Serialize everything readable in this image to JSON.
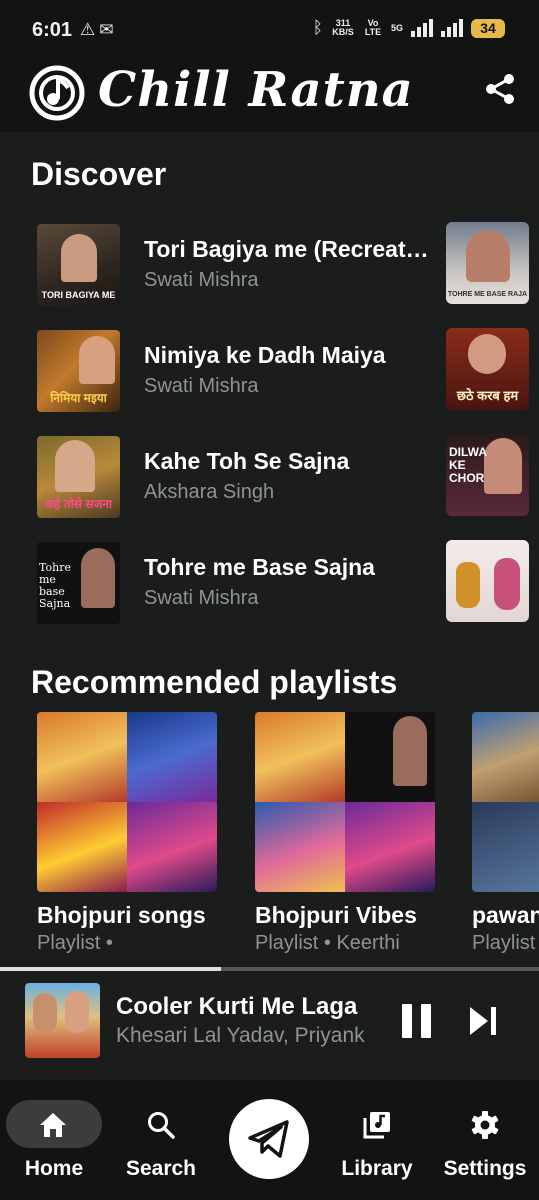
{
  "status": {
    "time": "6:01",
    "net_speed": "311 KB/S",
    "volte": "Vo LTE",
    "network": "5G",
    "battery": "34"
  },
  "header": {
    "brand": "Chill Ratna"
  },
  "discover": {
    "title": "Discover",
    "items": [
      {
        "title": "Tori Bagiya me (Recreated)",
        "artist": "Swati Mishra",
        "left_art_text": "TORI BAGIYA ME",
        "right_art_text": "TOHRE ME BASE RAJA"
      },
      {
        "title": "Nimiya ke Dadh Maiya",
        "artist": "Swati Mishra",
        "left_art_text": "निमिया मइया",
        "right_art_text": "छठे करब हम"
      },
      {
        "title": "Kahe Toh Se Sajna",
        "artist": "Akshara Singh",
        "left_art_text": "कहे तोसे सजना",
        "right_art_text": "DILWA KE CHOR"
      },
      {
        "title": "Tohre me Base Sajna",
        "artist": "Swati Mishra",
        "left_art_text": "Tohre me base Sajna",
        "right_art_text": ""
      }
    ]
  },
  "playlists": {
    "title": "Recommended playlists",
    "items": [
      {
        "title": "Bhojpuri songs",
        "subtitle": "Playlist •"
      },
      {
        "title": "Bhojpuri Vibes",
        "subtitle": "Playlist • Keerthi"
      },
      {
        "title": "pawan",
        "subtitle": "Playlist"
      }
    ]
  },
  "player": {
    "title": "Cooler Kurti Me Laga",
    "artist": "Khesari Lal Yadav, Priyank",
    "progress": 0.41
  },
  "nav": {
    "home": "Home",
    "search": "Search",
    "library": "Library",
    "settings": "Settings"
  },
  "colors": {
    "background": "#121414",
    "surface": "#1b1c1c",
    "secondary_text": "#8f9393",
    "nav_pill": "#3b3d3d"
  }
}
